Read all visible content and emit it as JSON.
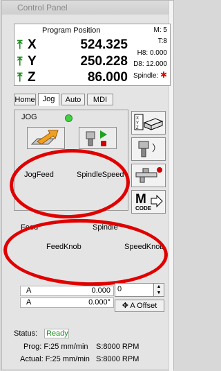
{
  "window": {
    "title": "Control Panel"
  },
  "position": {
    "title": "Program Position",
    "mode": "M: 5",
    "tool": "T:8",
    "h_offset": "H8: 0.000",
    "d_offset": "D8: 12.000",
    "spindle_label": "Spindle:",
    "spindle_indicator_color": "#dd0000",
    "axes": [
      {
        "name": "X",
        "value": "524.325"
      },
      {
        "name": "Y",
        "value": "250.228"
      },
      {
        "name": "Z",
        "value": "86.000"
      }
    ]
  },
  "tabs": [
    {
      "label": "Home"
    },
    {
      "label": "Jog"
    },
    {
      "label": "Auto"
    },
    {
      "label": "MDI"
    }
  ],
  "jog": {
    "label": "JOG",
    "led_color": "#3fd33f",
    "jog_feed_label": "JogFeed",
    "spindle_speed_label": "SpindleSpeed"
  },
  "side_buttons": [
    {
      "icon": "xyz-workpiece-icon"
    },
    {
      "icon": "spindle-tool-icon"
    },
    {
      "icon": "coolant-valve-icon"
    },
    {
      "icon": "m-code-icon",
      "text_top": "M",
      "text_bottom": "CODE"
    }
  ],
  "knobs": {
    "feed_label": "Feed",
    "spindle_label": "Spindle",
    "feed_knob_label": "FeedKnob",
    "speed_knob_label": "SpeedKnob"
  },
  "offset": {
    "rows": [
      {
        "axis": "A",
        "value": "0.000"
      },
      {
        "axis": "A",
        "value": "0.000°"
      }
    ],
    "spin_value": "0",
    "button_label": "A Offset"
  },
  "status": {
    "label": "Status:",
    "value": "Ready",
    "prog_label": "Prog:",
    "prog_feed": "F:25 mm/min",
    "prog_spindle": "S:8000 RPM",
    "actual_label": "Actual:",
    "actual_feed": "F:25 mm/min",
    "actual_spindle": "S:8000 RPM"
  },
  "colors": {
    "annotation": "#e00000",
    "ready": "#1b8a1b"
  }
}
